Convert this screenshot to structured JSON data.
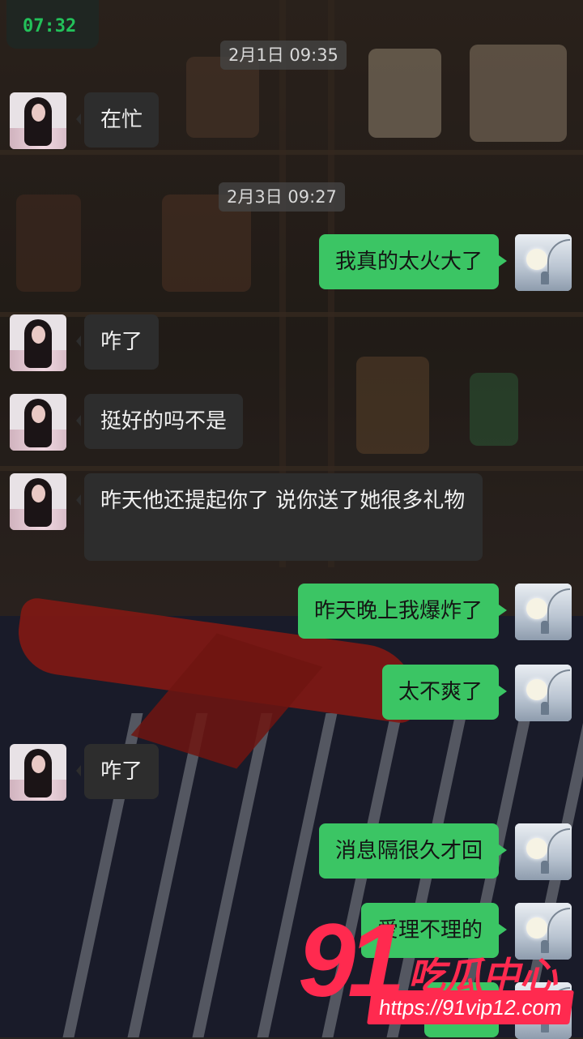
{
  "status": {
    "time": "07:32"
  },
  "timestamps": [
    "2月1日 09:35",
    "2月3日 09:27"
  ],
  "messages": [
    {
      "side": "in",
      "text": "在忙"
    },
    {
      "side": "out",
      "text": "我真的太火大了"
    },
    {
      "side": "in",
      "text": "咋了"
    },
    {
      "side": "in",
      "text": "挺好的吗不是"
    },
    {
      "side": "in",
      "text": "昨天他还提起你了 说你送了她很多礼物"
    },
    {
      "side": "out",
      "text": "昨天晚上我爆炸了"
    },
    {
      "side": "out",
      "text": "太不爽了"
    },
    {
      "side": "in",
      "text": "咋了"
    },
    {
      "side": "out",
      "text": "消息隔很久才回"
    },
    {
      "side": "out",
      "text": "爱理不理的"
    },
    {
      "side": "out",
      "text": "说要"
    }
  ],
  "watermark": {
    "number": "91",
    "name": "吃瓜中心",
    "url": "https://91vip12.com"
  },
  "colors": {
    "outgoing_bubble": "#3bc564",
    "incoming_bubble": "#2d2d2d",
    "status_time": "#23c15a",
    "watermark": "#ff2a4f"
  }
}
